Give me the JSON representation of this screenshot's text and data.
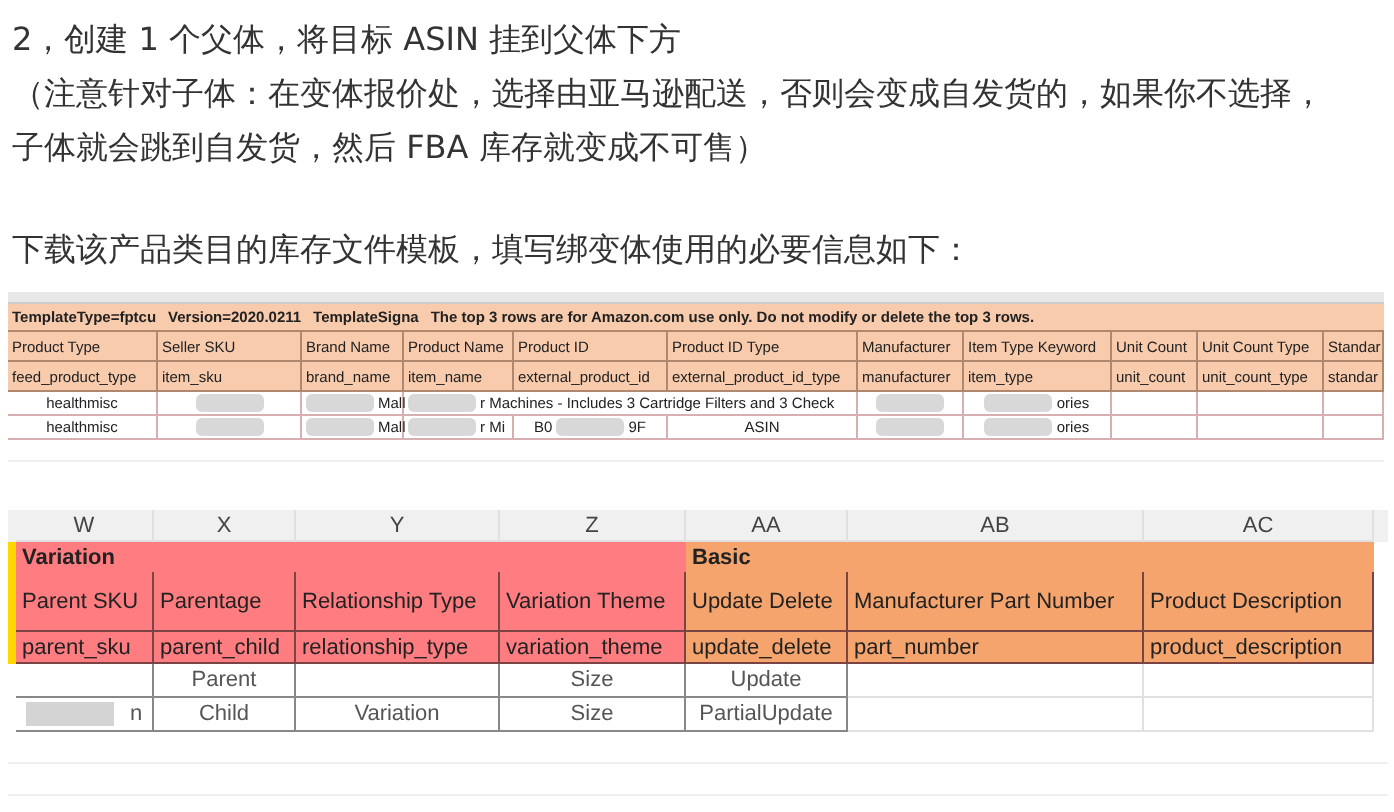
{
  "paragraphs": [
    {
      "lines": [
        "2，创建 1 个父体，将目标 ASIN 挂到父体下方"
      ]
    },
    {
      "lines": [
        "（注意针对子体：在变体报价处，选择由亚马逊配送，否则会变成自发货的，如果你不选择，",
        "子体就会跳到自发货，然后 FBA 库存就变成不可售）"
      ]
    },
    {
      "lines": [
        "下载该产品类目的库存文件模板，填写绑变体使用的必要信息如下："
      ]
    }
  ],
  "template_sheet": {
    "banner": [
      "TemplateType=fptcu",
      "Version=2020.0211",
      "TemplateSigna",
      "The top 3 rows are for Amazon.com use only. Do not modify or delete the top 3 rows."
    ],
    "headers": [
      "Product Type",
      "Seller SKU",
      "Brand Name",
      "Product Name",
      "Product ID",
      "Product ID Type",
      "Manufacturer",
      "Item Type Keyword",
      "Unit Count",
      "Unit Count Type",
      "Standar"
    ],
    "fields": [
      "feed_product_type",
      "item_sku",
      "brand_name",
      "item_name",
      "external_product_id",
      "external_product_id_type",
      "manufacturer",
      "item_type",
      "unit_count",
      "unit_count_type",
      "standar"
    ],
    "rows": [
      {
        "cells": [
          {
            "parts": [
              {
                "kind": "text",
                "text": "healthmisc"
              }
            ]
          },
          {
            "parts": [
              {
                "kind": "blur"
              }
            ]
          },
          {
            "parts": [
              {
                "kind": "blur"
              },
              {
                "kind": "text",
                "text": "Mall"
              }
            ]
          },
          {
            "parts": [
              {
                "kind": "blur"
              },
              {
                "kind": "text",
                "text": "r Machines - Includes 3 Cartridge Filters and 3 Check"
              }
            ]
          },
          {},
          {},
          {
            "parts": [
              {
                "kind": "blur"
              }
            ]
          },
          {
            "parts": [
              {
                "kind": "blur"
              },
              {
                "kind": "text",
                "text": "ories"
              }
            ]
          },
          {},
          {},
          {}
        ]
      },
      {
        "cells": [
          {
            "parts": [
              {
                "kind": "text",
                "text": "healthmisc"
              }
            ]
          },
          {
            "parts": [
              {
                "kind": "blur"
              }
            ]
          },
          {
            "parts": [
              {
                "kind": "blur"
              },
              {
                "kind": "text",
                "text": "Mall"
              }
            ]
          },
          {
            "parts": [
              {
                "kind": "blur"
              },
              {
                "kind": "text",
                "text": "r Mi"
              }
            ]
          },
          {
            "parts": [
              {
                "kind": "text",
                "text": "B0"
              },
              {
                "kind": "blur"
              },
              {
                "kind": "text",
                "text": "9F"
              }
            ]
          },
          {
            "parts": [
              {
                "kind": "text",
                "text": "ASIN"
              }
            ]
          },
          {
            "parts": [
              {
                "kind": "blur"
              }
            ]
          },
          {
            "parts": [
              {
                "kind": "blur"
              },
              {
                "kind": "text",
                "text": "ories"
              }
            ]
          },
          {},
          {},
          {}
        ]
      }
    ]
  },
  "variation_sheet": {
    "columns": [
      "W",
      "X",
      "Y",
      "Z",
      "AA",
      "AB",
      "AC"
    ],
    "groups": [
      {
        "label": "Variation",
        "color": "#ff7c80"
      },
      {
        "label": "Basic",
        "color": "#f4a46c"
      }
    ],
    "headers": [
      "Parent SKU",
      "Parentage",
      "Relationship Type",
      "Variation Theme",
      "Update Delete",
      "Manufacturer Part Number",
      "Product Description"
    ],
    "fields": [
      "parent_sku",
      "parent_child",
      "relationship_type",
      "variation_theme",
      "update_delete",
      "part_number",
      "product_description"
    ],
    "rows": [
      {
        "cells": [
          {},
          {
            "parts": [
              {
                "kind": "text",
                "text": "Parent"
              }
            ]
          },
          {},
          {
            "parts": [
              {
                "kind": "text",
                "text": "Size"
              }
            ]
          },
          {
            "parts": [
              {
                "kind": "text",
                "text": "Update"
              }
            ]
          },
          {},
          {}
        ]
      },
      {
        "cells": [
          {
            "parts": [
              {
                "kind": "blur"
              },
              {
                "kind": "text",
                "text": "n"
              }
            ]
          },
          {
            "parts": [
              {
                "kind": "text",
                "text": "Child"
              }
            ]
          },
          {
            "parts": [
              {
                "kind": "text",
                "text": "Variation"
              }
            ]
          },
          {
            "parts": [
              {
                "kind": "text",
                "text": "Size"
              }
            ]
          },
          {
            "parts": [
              {
                "kind": "text",
                "text": "PartialUpdate"
              }
            ]
          },
          {},
          {}
        ]
      }
    ]
  }
}
